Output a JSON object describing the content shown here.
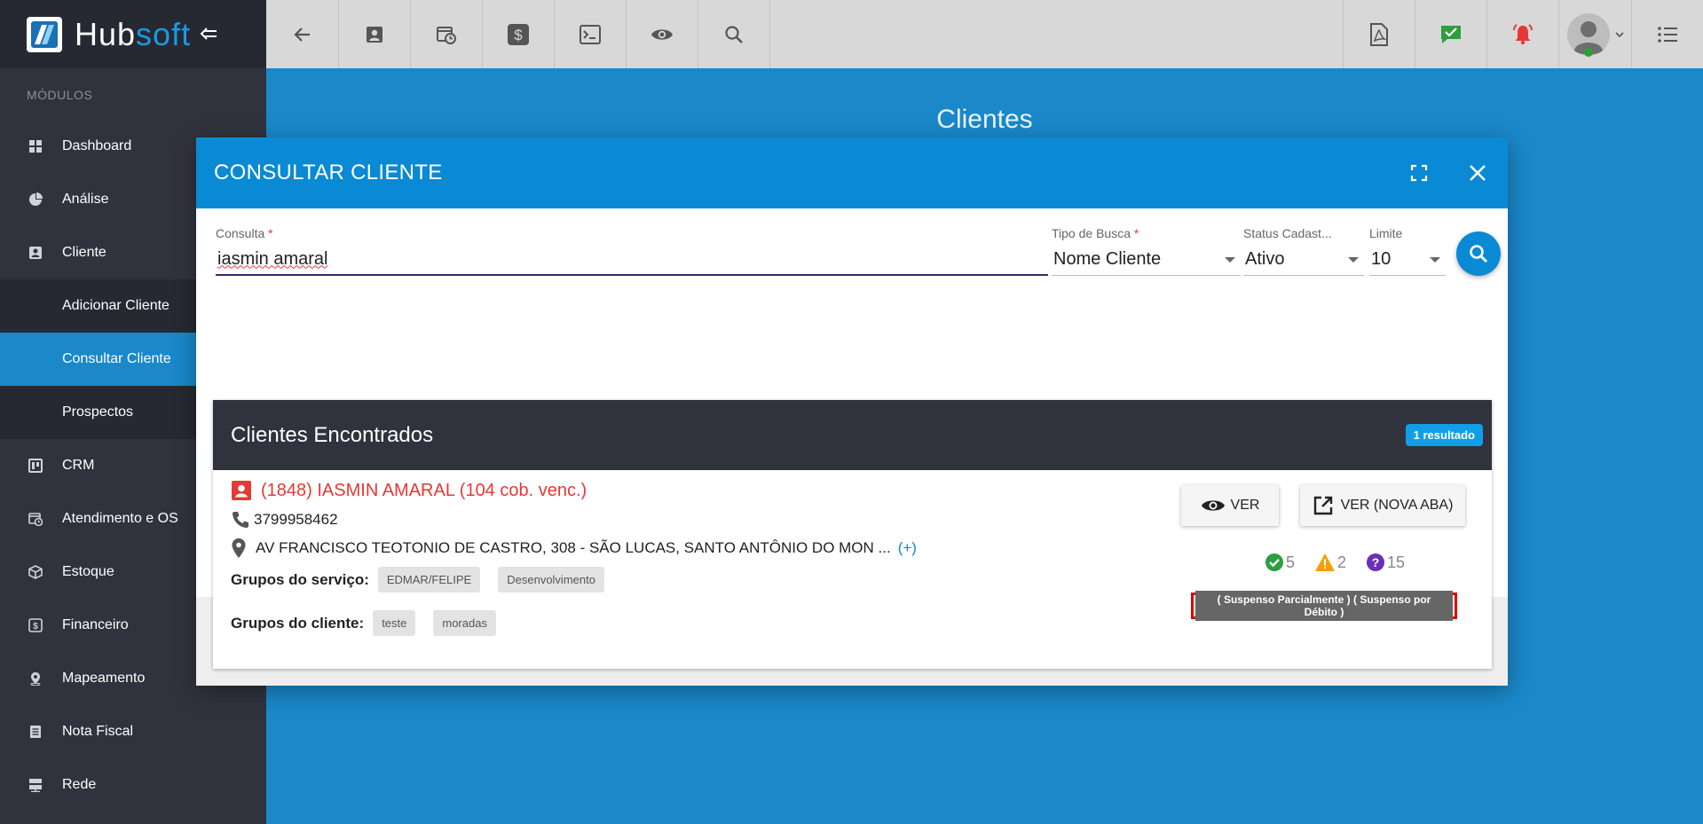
{
  "brand": {
    "name_part1": "Hub",
    "name_part2": "soft"
  },
  "sidebar": {
    "section_label": "MÓDULOS",
    "items": [
      {
        "label": "Dashboard",
        "icon": "dashboard-icon"
      },
      {
        "label": "Análise",
        "icon": "pie-chart-icon"
      },
      {
        "label": "Cliente",
        "icon": "contact-card-icon"
      },
      {
        "label": "Adicionar Cliente",
        "sub": true
      },
      {
        "label": "Consultar Cliente",
        "sub": true,
        "active": true
      },
      {
        "label": "Prospectos",
        "sub": true
      },
      {
        "label": "CRM",
        "icon": "trello-icon"
      },
      {
        "label": "Atendimento e OS",
        "icon": "calendar-clock-icon"
      },
      {
        "label": "Estoque",
        "icon": "box-icon"
      },
      {
        "label": "Financeiro",
        "icon": "money-icon"
      },
      {
        "label": "Mapeamento",
        "icon": "map-pin-icon"
      },
      {
        "label": "Nota Fiscal",
        "icon": "receipt-icon"
      },
      {
        "label": "Rede",
        "icon": "server-icon"
      }
    ]
  },
  "page": {
    "title": "Clientes"
  },
  "modal": {
    "title": "CONSULTAR CLIENTE",
    "form": {
      "consulta_label": "Consulta",
      "consulta_value": "iasmin amaral",
      "tipo_label": "Tipo de Busca",
      "tipo_value": "Nome Cliente",
      "status_label": "Status Cadast...",
      "status_value": "Ativo",
      "limite_label": "Limite",
      "limite_value": "10",
      "required_mark": "*"
    },
    "results": {
      "title": "Clientes Encontrados",
      "badge": "1 resultado",
      "client": {
        "name": "(1848) IASMIN AMARAL (104 cob. venc.)",
        "phone": "3799958462",
        "address": "AV FRANCISCO TEOTONIO DE CASTRO, 308 - SÃO LUCAS, SANTO ANTÔNIO DO MON ...",
        "address_more": "(+)",
        "service_groups_label": "Grupos do serviço:",
        "service_groups": [
          "EDMAR/FELIPE",
          "Desenvolvimento"
        ],
        "client_groups_label": "Grupos do cliente:",
        "client_groups": [
          "teste",
          "moradas"
        ],
        "ver_label": "VER",
        "ver_nova_label": "VER (NOVA ABA)",
        "count_ok": "5",
        "count_warn": "2",
        "count_question": "15",
        "status_text": "( Suspenso Parcialmente ) ( Suspenso por Débito )"
      }
    }
  },
  "colors": {
    "primary": "#0a8ad4",
    "background": "#1a88c9",
    "sidebar": "#30333e",
    "danger": "#e53935"
  }
}
